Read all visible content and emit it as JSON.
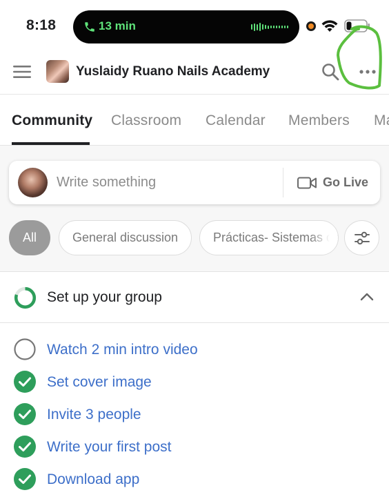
{
  "status_bar": {
    "time": "8:18",
    "call_duration": "13 min",
    "call_color": "#5fe37a"
  },
  "header": {
    "group_name": "Yuslaidy Ruano Nails Academy",
    "icons": [
      "menu-icon",
      "search-icon",
      "more-icon"
    ]
  },
  "tabs": [
    {
      "label": "Community",
      "active": true
    },
    {
      "label": "Classroom",
      "active": false
    },
    {
      "label": "Calendar",
      "active": false
    },
    {
      "label": "Members",
      "active": false
    },
    {
      "label": "Ma",
      "active": false
    }
  ],
  "composer": {
    "placeholder": "Write something",
    "go_live_label": "Go Live"
  },
  "filters": {
    "chips": [
      "All",
      "General discussion",
      "Prácticas- Sistemas de"
    ],
    "selected": "All"
  },
  "setup": {
    "title": "Set up your group",
    "progress": 0.8,
    "accent": "#2e9e5b",
    "link_color": "#3d6fc9",
    "items": [
      {
        "label": "Watch 2 min intro video",
        "done": false
      },
      {
        "label": "Set cover image",
        "done": true
      },
      {
        "label": "Invite 3 people",
        "done": true
      },
      {
        "label": "Write your first post",
        "done": true
      },
      {
        "label": "Download app",
        "done": true
      }
    ]
  }
}
